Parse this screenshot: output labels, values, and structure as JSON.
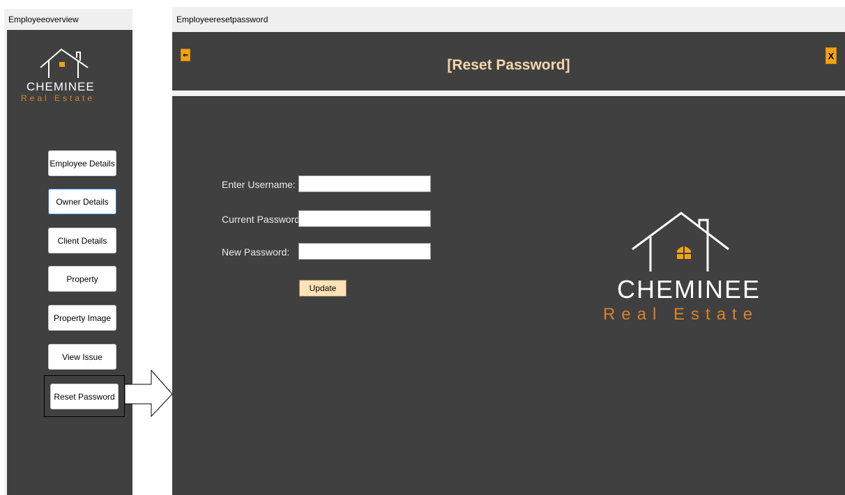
{
  "overview_window": {
    "title": "Employeeoverview",
    "logo": {
      "name": "CHEMINEE",
      "tagline": "Real Estate"
    },
    "nav": [
      {
        "label": "Employee Details"
      },
      {
        "label": "Owner Details"
      },
      {
        "label": "Client Details"
      },
      {
        "label": "Property"
      },
      {
        "label": "Property Image"
      },
      {
        "label": "View Issue"
      },
      {
        "label": "Reset Password"
      }
    ]
  },
  "reset_window": {
    "title": "Employeeresetpassword",
    "header_title": "[Reset Password]",
    "back_icon": "back-arrow-icon",
    "close_label": "X",
    "form": {
      "username_label": "Enter Username:",
      "username_value": "",
      "current_password_label": "Current Password:",
      "current_password_value": "",
      "new_password_label": "New Password:",
      "new_password_value": "",
      "update_label": "Update"
    },
    "logo": {
      "name": "CHEMINEE",
      "tagline": "Real Estate"
    }
  },
  "colors": {
    "panel_dark": "#404040",
    "accent_orange": "#f2a30f",
    "title_cream": "#f5d7a8",
    "tagline_orange": "#d9822b"
  }
}
